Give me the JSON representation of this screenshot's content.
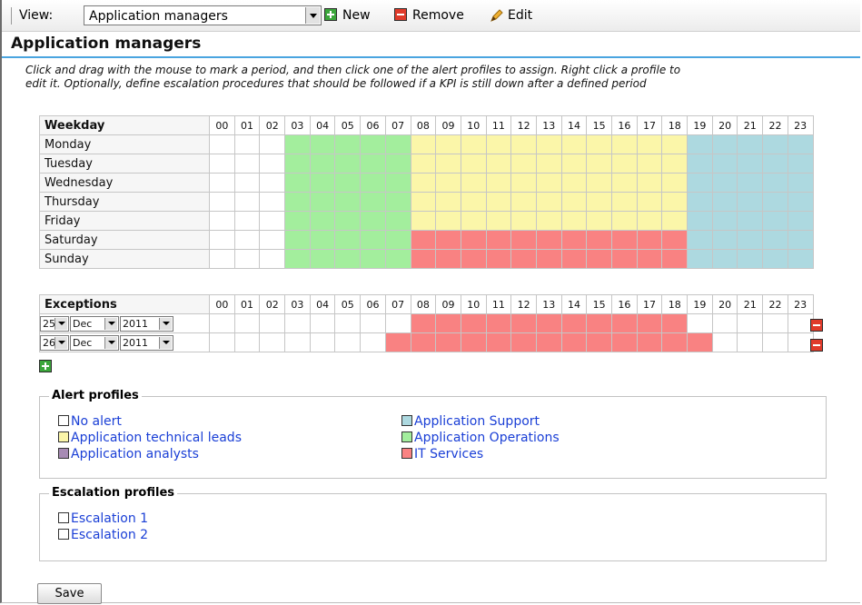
{
  "toolbar": {
    "view_label": "View:",
    "view_value": "Application managers",
    "new_label": "New",
    "remove_label": "Remove",
    "edit_label": "Edit"
  },
  "page": {
    "title": "Application managers",
    "intro_line1": "Click and drag with the mouse to mark a period, and then click one of the alert profiles to assign. Right click a profile to",
    "intro_line2": "edit it. Optionally, define escalation procedures that should be followed if a KPI is still down after a defined period"
  },
  "hours": [
    "00",
    "01",
    "02",
    "03",
    "04",
    "05",
    "06",
    "07",
    "08",
    "09",
    "10",
    "11",
    "12",
    "13",
    "14",
    "15",
    "16",
    "17",
    "18",
    "19",
    "20",
    "21",
    "22",
    "23"
  ],
  "weekday": {
    "header": "Weekday",
    "rows": [
      {
        "day": "Monday",
        "cells": "wwwgggggyyyyyyyyyyybbbbb"
      },
      {
        "day": "Tuesday",
        "cells": "wwwgggggyyyyyyyyyyybbbbb"
      },
      {
        "day": "Wednesday",
        "cells": "wwwgggggyyyyyyyyyyybbbbb"
      },
      {
        "day": "Thursday",
        "cells": "wwwgggggyyyyyyyyyyybbbbb"
      },
      {
        "day": "Friday",
        "cells": "wwwgggggyyyyyyyyyyybbbbb"
      },
      {
        "day": "Saturday",
        "cells": "wwwgggggrrrrrrrrrrrbbbbb"
      },
      {
        "day": "Sunday",
        "cells": "wwwgggggrrrrrrrrrrrbbbbb"
      }
    ]
  },
  "exceptions": {
    "header": "Exceptions",
    "rows": [
      {
        "day": "25",
        "month": "Dec",
        "year": "2011",
        "cells": "wwwwwwwwrrrrrrrrrrrwwwww"
      },
      {
        "day": "26",
        "month": "Dec",
        "year": "2011",
        "cells": "wwwwwwwrrrrrrrrrrrrrwwww"
      }
    ]
  },
  "profile_colors": {
    "w": "#ffffff",
    "g": "#a3ee9d",
    "y": "#fbf6a9",
    "b": "#add9e0",
    "r": "#f98282",
    "p": "#a78bb4"
  },
  "alert_profiles": {
    "legend": "Alert profiles",
    "items": [
      {
        "label": "No alert",
        "color": "#ffffff"
      },
      {
        "label": "Application technical leads",
        "color": "#fbf6a9"
      },
      {
        "label": "Application analysts",
        "color": "#a78bb4"
      },
      {
        "label": "Application Support",
        "color": "#add9e0"
      },
      {
        "label": "Application Operations",
        "color": "#a3ee9d"
      },
      {
        "label": "IT Services",
        "color": "#f98282"
      }
    ]
  },
  "escalation_profiles": {
    "legend": "Escalation profiles",
    "items": [
      {
        "label": "Escalation 1",
        "color": "#ffffff"
      },
      {
        "label": "Escalation 2",
        "color": "#ffffff"
      }
    ]
  },
  "save_label": "Save"
}
